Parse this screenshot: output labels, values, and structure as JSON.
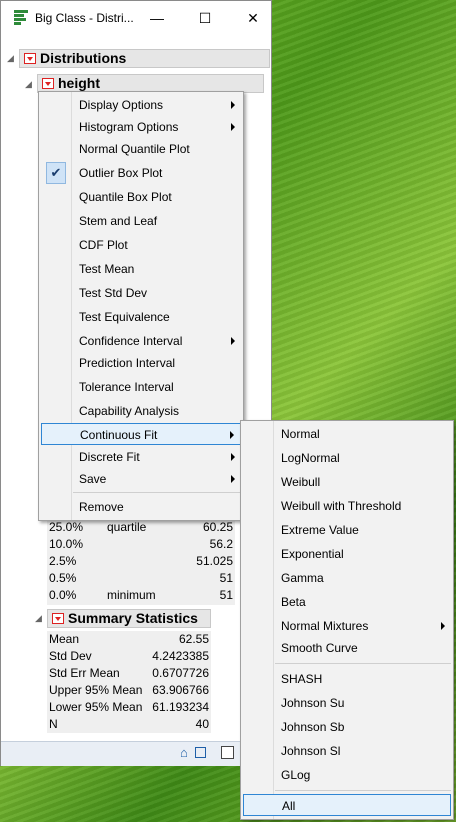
{
  "window": {
    "title": "Big Class - Distri...",
    "minimize_glyph": "—",
    "maximize_glyph": "☐",
    "close_glyph": "✕"
  },
  "report": {
    "distributions_title": "Distributions",
    "height_title": "height"
  },
  "quantiles": [
    {
      "pct": "25.0%",
      "label": "quartile",
      "value": "60.25"
    },
    {
      "pct": "10.0%",
      "label": "",
      "value": "56.2"
    },
    {
      "pct": "2.5%",
      "label": "",
      "value": "51.025"
    },
    {
      "pct": "0.5%",
      "label": "",
      "value": "51"
    },
    {
      "pct": "0.0%",
      "label": "minimum",
      "value": "51"
    }
  ],
  "summary": {
    "title": "Summary Statistics",
    "rows": [
      {
        "label": "Mean",
        "value": "62.55"
      },
      {
        "label": "Std Dev",
        "value": "4.2423385"
      },
      {
        "label": "Std Err Mean",
        "value": "0.6707726"
      },
      {
        "label": "Upper 95% Mean",
        "value": "63.906766"
      },
      {
        "label": "Lower 95% Mean",
        "value": "61.193234"
      },
      {
        "label": "N",
        "value": "40"
      }
    ]
  },
  "menu": {
    "items": [
      {
        "label": "Display Options",
        "submenu": true
      },
      {
        "label": "Histogram Options",
        "submenu": true
      },
      {
        "label": "Normal Quantile Plot"
      },
      {
        "label": "Outlier Box Plot",
        "checked": true
      },
      {
        "label": "Quantile Box Plot"
      },
      {
        "label": "Stem and Leaf"
      },
      {
        "label": "CDF Plot"
      },
      {
        "label": "Test Mean"
      },
      {
        "label": "Test Std Dev"
      },
      {
        "label": "Test Equivalence"
      },
      {
        "label": "Confidence Interval",
        "submenu": true
      },
      {
        "label": "Prediction Interval"
      },
      {
        "label": "Tolerance Interval"
      },
      {
        "label": "Capability Analysis"
      },
      {
        "label": "Continuous Fit",
        "submenu": true,
        "highlighted": true
      },
      {
        "label": "Discrete Fit",
        "submenu": true
      },
      {
        "label": "Save",
        "submenu": true
      },
      {
        "label": "Remove"
      }
    ]
  },
  "submenu": {
    "items": [
      {
        "label": "Normal"
      },
      {
        "label": "LogNormal"
      },
      {
        "label": "Weibull"
      },
      {
        "label": "Weibull with Threshold"
      },
      {
        "label": "Extreme Value"
      },
      {
        "label": "Exponential"
      },
      {
        "label": "Gamma"
      },
      {
        "label": "Beta"
      },
      {
        "label": "Normal Mixtures",
        "submenu": true
      },
      {
        "label": "Smooth Curve"
      },
      {
        "label": "SHASH"
      },
      {
        "label": "Johnson Su"
      },
      {
        "label": "Johnson Sb"
      },
      {
        "label": "Johnson Sl"
      },
      {
        "label": "GLog"
      },
      {
        "label": "All",
        "highlighted": true
      }
    ]
  },
  "colors": {
    "accent_red": "#dd2222",
    "highlight_border": "#2f86d4",
    "highlight_fill": "#e5f1fb"
  }
}
